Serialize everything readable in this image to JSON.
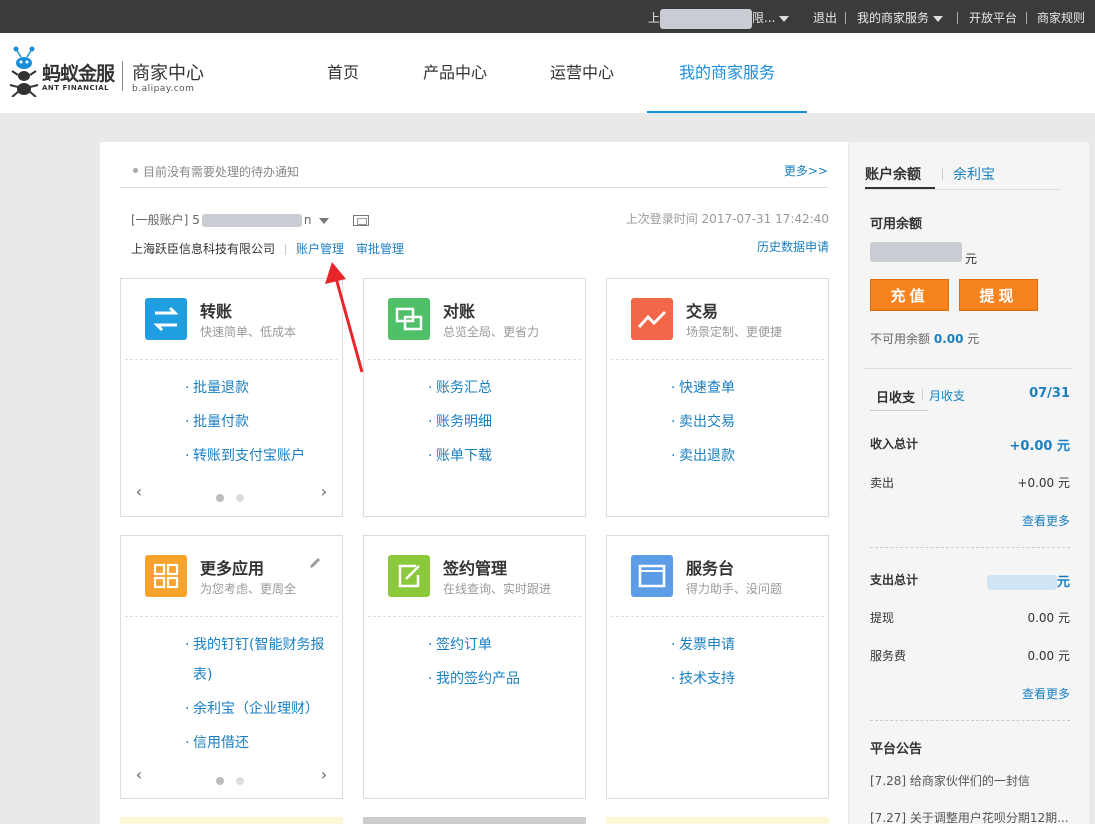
{
  "topbar": {
    "user_prefix": "上",
    "user_suffix": "限...",
    "logout": "退出",
    "merchant_service": "我的商家服务",
    "open_platform": "开放平台",
    "merchant_rules": "商家规则"
  },
  "logo": {
    "brand": "蚂蚁金服",
    "brand_en": "ANT FINANCIAL",
    "center": "商家中心",
    "domain": "b.alipay.com"
  },
  "nav": [
    {
      "label": "首页"
    },
    {
      "label": "产品中心"
    },
    {
      "label": "运营中心"
    },
    {
      "label": "我的商家服务"
    }
  ],
  "notice": {
    "text": "目前没有需要处理的待办通知",
    "more": "更多>>"
  },
  "account": {
    "type": "[一般账户]",
    "id_prefix": "5",
    "id_suffix": "n",
    "last_login": "上次登录时间 2017-07-31 17:42:40",
    "company": "上海跃臣信息科技有限公司",
    "account_mgmt": "账户管理",
    "approval_mgmt": "审批管理",
    "history": "历史数据申请"
  },
  "tiles": [
    {
      "title": "转账",
      "subtitle": "快速简单、低成本",
      "icon": "transfer-icon",
      "color": "#1f9ee2",
      "links": [
        "批量退款",
        "批量付款",
        "转账到支付宝账户"
      ]
    },
    {
      "title": "对账",
      "subtitle": "总览全局、更省力",
      "icon": "reconcile-icon",
      "color": "#4fc068",
      "links": [
        "账务汇总",
        "账务明细",
        "账单下载"
      ]
    },
    {
      "title": "交易",
      "subtitle": "场景定制、更便捷",
      "icon": "trade-icon",
      "color": "#f2674a",
      "links": [
        "快速查单",
        "卖出交易",
        "卖出退款"
      ]
    },
    {
      "title": "更多应用",
      "subtitle": "为您考虑、更周全",
      "icon": "apps-icon",
      "color": "#f9a32c",
      "links": [
        "我的钉钉(智能财务报表)",
        "余利宝（企业理财）",
        "信用借还"
      ]
    },
    {
      "title": "签约管理",
      "subtitle": "在线查询、实时跟进",
      "icon": "contract-icon",
      "color": "#8bc83c",
      "links": [
        "签约订单",
        "我的签约产品"
      ]
    },
    {
      "title": "服务台",
      "subtitle": "得力助手、没问题",
      "icon": "service-icon",
      "color": "#5d9ce6",
      "links": [
        "发票申请",
        "技术支持"
      ]
    }
  ],
  "side": {
    "tab_balance": "账户余额",
    "tab_yulibao": "余利宝",
    "available_label": "可用余额",
    "unit": "元",
    "recharge": "充值",
    "withdraw": "提现",
    "unavailable_label": "不可用余额",
    "unavailable_value": "0.00",
    "daily": "日收支",
    "monthly": "月收支",
    "date": "07/31",
    "income_total_label": "收入总计",
    "income_total_value": "+0.00 元",
    "sell_label": "卖出",
    "sell_value": "+0.00 元",
    "see_more": "查看更多",
    "expense_total_label": "支出总计",
    "expense_unit": "元",
    "withdraw_label": "提现",
    "withdraw_value": "0.00 元",
    "fee_label": "服务费",
    "fee_value": "0.00 元",
    "announce_title": "平台公告",
    "announcements": [
      "[7.28] 给商家伙伴们的一封信",
      "[7.27] 关于调整用户花呗分期12期..."
    ]
  }
}
